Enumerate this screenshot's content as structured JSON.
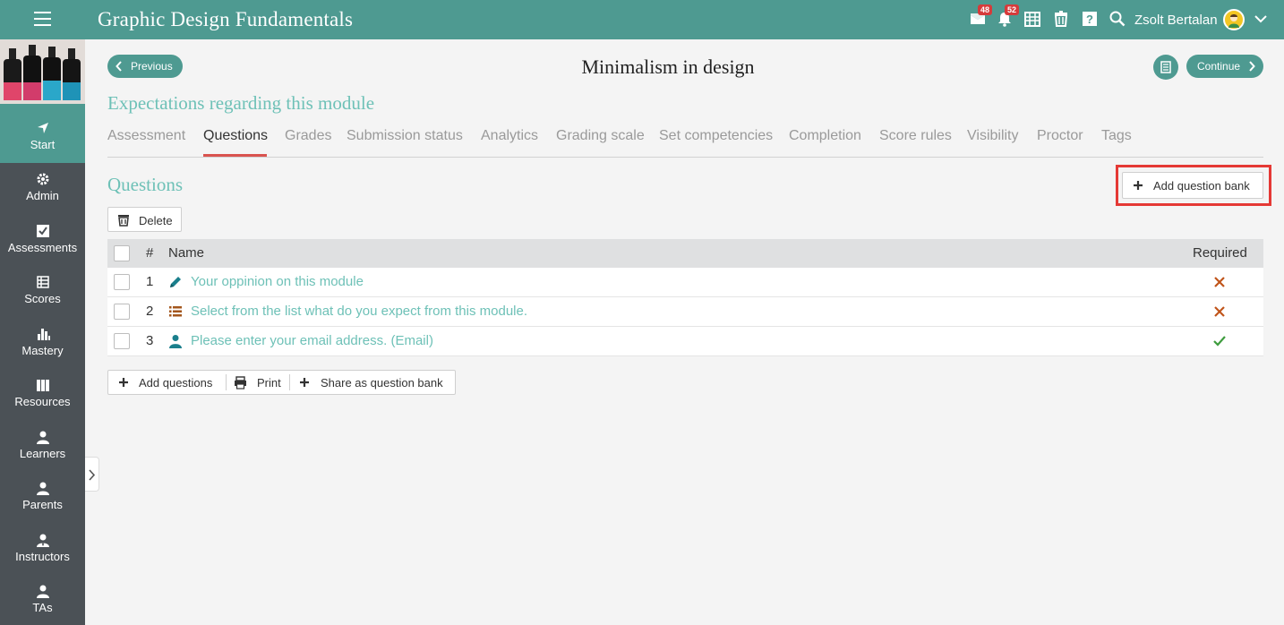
{
  "app": {
    "title": "Graphic Design Fundamentals",
    "user_name": "Zsolt Bertalan",
    "messages_count": "48",
    "notifications_count": "52",
    "accent_color": "#4e9a91"
  },
  "sidebar": {
    "items": [
      {
        "label": "Start",
        "icon": "navigate-arrow-icon"
      },
      {
        "label": "Admin",
        "icon": "gear-icon"
      },
      {
        "label": "Assessments",
        "icon": "checkbox-icon"
      },
      {
        "label": "Scores",
        "icon": "table-icon"
      },
      {
        "label": "Mastery",
        "icon": "bar-chart-icon"
      },
      {
        "label": "Resources",
        "icon": "books-icon"
      },
      {
        "label": "Learners",
        "icon": "person-icon"
      },
      {
        "label": "Parents",
        "icon": "person-icon"
      },
      {
        "label": "Instructors",
        "icon": "instructor-icon"
      },
      {
        "label": "TAs",
        "icon": "person-icon"
      }
    ]
  },
  "header": {
    "previous_label": "Previous",
    "continue_label": "Continue",
    "page_title": "Minimalism in design",
    "section_title": "Expectations regarding this module"
  },
  "tabs": [
    {
      "label": "Assessment",
      "active": false
    },
    {
      "label": "Questions",
      "active": true
    },
    {
      "label": "Grades",
      "active": false
    },
    {
      "label": "Submission status",
      "active": false
    },
    {
      "label": "Analytics",
      "active": false
    },
    {
      "label": "Grading scale",
      "active": false
    },
    {
      "label": "Set competencies",
      "active": false
    },
    {
      "label": "Completion",
      "active": false
    },
    {
      "label": "Score rules",
      "active": false
    },
    {
      "label": "Visibility",
      "active": false
    },
    {
      "label": "Proctor",
      "active": false
    },
    {
      "label": "Tags",
      "active": false
    }
  ],
  "questions": {
    "heading": "Questions",
    "add_bank_label": "Add question bank",
    "delete_label": "Delete",
    "columns": {
      "num": "#",
      "name": "Name",
      "required": "Required"
    },
    "rows": [
      {
        "num": "1",
        "name": "Your oppinion on this module",
        "icon": "pencil-icon",
        "required": false
      },
      {
        "num": "2",
        "name": "Select from the list what do you expect from this module.",
        "icon": "list-icon",
        "required": false
      },
      {
        "num": "3",
        "name": "Please enter your email address. (Email)",
        "icon": "person-icon",
        "required": true
      }
    ],
    "add_questions_label": "Add questions",
    "print_label": "Print",
    "share_label": "Share as question bank"
  }
}
